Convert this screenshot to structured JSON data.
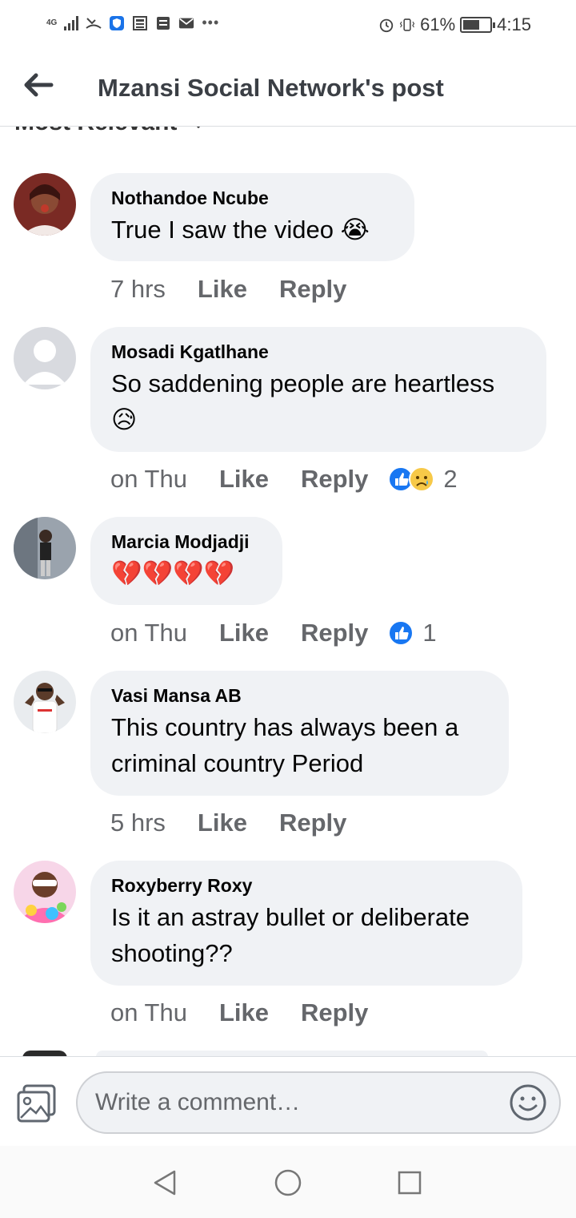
{
  "status_bar": {
    "network": "4G",
    "battery_percent": "61%",
    "battery_level": 0.61,
    "time": "4:15",
    "icons": [
      "signal-icon",
      "missed-call-icon",
      "shield-icon",
      "news-icon",
      "news-icon",
      "mail-icon",
      "more-icon",
      "alarm-icon",
      "vibrate-icon",
      "battery-icon"
    ]
  },
  "header": {
    "title": "Mzansi Social Network's post",
    "back_icon": "back-arrow-icon"
  },
  "sort": {
    "label": "Most Relevant",
    "icon": "chevron-down-icon"
  },
  "comments": [
    {
      "name": "Nothandoe Ncube",
      "text": "True I saw the video 😭",
      "time": "7 hrs",
      "like": "Like",
      "reply": "Reply",
      "reactions": [],
      "reaction_count": ""
    },
    {
      "name": "Mosadi Kgatlhane",
      "text": "So saddening people are heartless 😥",
      "time": "on Thu",
      "like": "Like",
      "reply": "Reply",
      "reactions": [
        "like-reaction-icon",
        "sad-reaction-icon"
      ],
      "reaction_count": "2"
    },
    {
      "name": "Marcia Modjadji",
      "text": "💔💔💔💔",
      "time": "on Thu",
      "like": "Like",
      "reply": "Reply",
      "reactions": [
        "like-reaction-icon"
      ],
      "reaction_count": "1"
    },
    {
      "name": "Vasi Mansa AB",
      "text": "This country has always been a criminal country Period",
      "time": "5 hrs",
      "like": "Like",
      "reply": "Reply",
      "reactions": [],
      "reaction_count": ""
    },
    {
      "name": "Roxyberry Roxy",
      "text": "Is it an astray bullet or deliberate shooting??",
      "time": "on Thu",
      "like": "Like",
      "reply": "Reply",
      "reactions": [],
      "reaction_count": ""
    }
  ],
  "composer": {
    "placeholder": "Write a comment…",
    "photo_icon": "photo-icon",
    "emoji_icon": "emoji-icon"
  },
  "nav": {
    "icons": [
      "back-triangle-icon",
      "home-circle-icon",
      "recents-square-icon"
    ]
  },
  "colors": {
    "bubble": "#f0f2f5",
    "secondary_text": "#65676b",
    "like_blue": "#1877f2"
  }
}
